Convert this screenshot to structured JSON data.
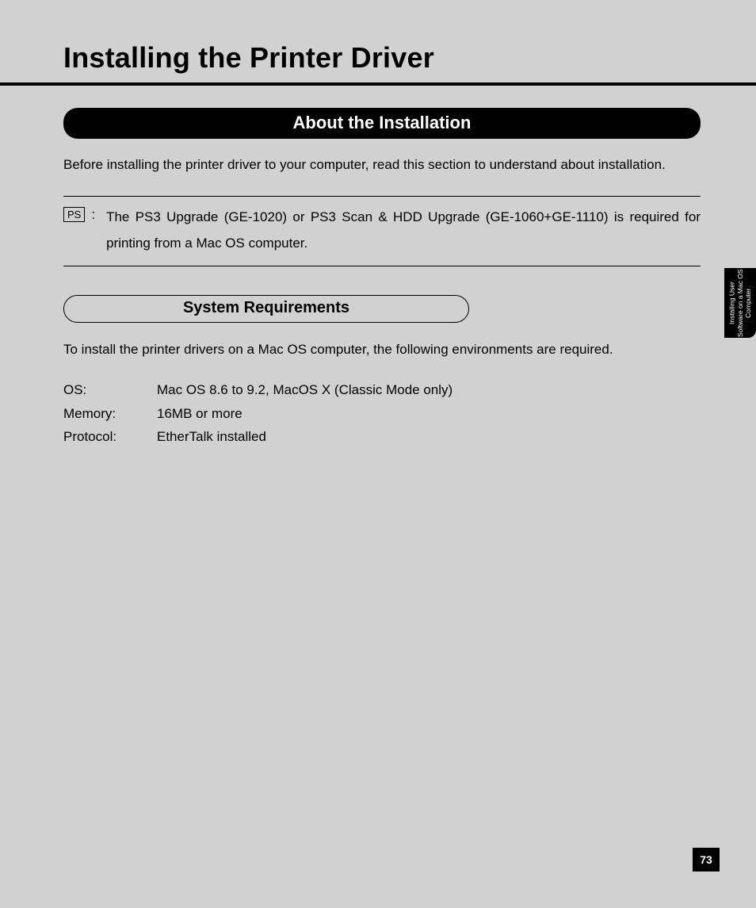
{
  "chapter_title": "Installing the Printer Driver",
  "section_heading": "About the Installation",
  "intro_text": "Before installing the printer driver to your computer, read this section to understand about installation.",
  "ps_note": {
    "badge": "PS",
    "text": "The PS3 Upgrade (GE-1020) or PS3 Scan & HDD Upgrade (GE-1060+GE-1110) is required for printing from a Mac OS computer."
  },
  "sub_section_heading": "System Requirements",
  "requirements_intro": "To install the printer drivers on a Mac OS computer, the following environments are required.",
  "requirements": [
    {
      "label": "OS:",
      "value": "Mac OS 8.6 to 9.2, MacOS X (Classic Mode only)"
    },
    {
      "label": "Memory:",
      "value": "16MB or more"
    },
    {
      "label": "Protocol:",
      "value": "EtherTalk installed"
    }
  ],
  "side_tab": "Installing User Software on a Mac OS Computer",
  "page_number": "73"
}
